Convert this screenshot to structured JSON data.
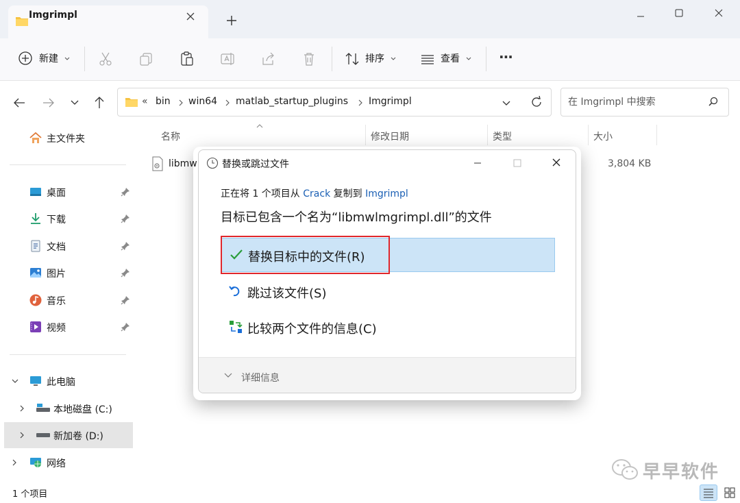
{
  "tab": {
    "title": "Imgrimpl",
    "icon": "folder-icon",
    "add": "+"
  },
  "toolbar": {
    "new_label": "新建",
    "sort_label": "排序",
    "view_label": "查看",
    "more": "···"
  },
  "address": {
    "overflow": "«",
    "crumbs": [
      "bin",
      "win64",
      "matlab_startup_plugins",
      "Imgrimpl"
    ]
  },
  "search": {
    "placeholder": "在 Imgrimpl 中搜索"
  },
  "sidebar": {
    "home": "主文件夹",
    "pinned": [
      {
        "label": "桌面",
        "icon": "desktop-icon"
      },
      {
        "label": "下载",
        "icon": "download-icon"
      },
      {
        "label": "文档",
        "icon": "document-icon"
      },
      {
        "label": "图片",
        "icon": "picture-icon"
      },
      {
        "label": "音乐",
        "icon": "music-icon"
      },
      {
        "label": "视频",
        "icon": "video-icon"
      }
    ],
    "this_pc": "此电脑",
    "drive_c": "本地磁盘 (C:)",
    "drive_d": "新加卷 (D:)",
    "network": "网络"
  },
  "columns": {
    "name": "名称",
    "date": "修改日期",
    "type": "类型",
    "size": "大小"
  },
  "file": {
    "name": "libmw",
    "size": "3,804 KB"
  },
  "status": {
    "count": "1 个项目"
  },
  "dialog": {
    "title": "替换或跳过文件",
    "from_prefix": "正在将 1 个项目从 ",
    "from_source": "Crack",
    "from_mid": " 复制到 ",
    "from_dest": "Imgrimpl",
    "contains": "目标已包含一个名为“libmwlmgrimpl.dll”的文件",
    "opt_replace": "替换目标中的文件(R)",
    "opt_skip": "跳过该文件(S)",
    "opt_compare": "比较两个文件的信息(C)",
    "details": "详细信息"
  },
  "watermark": {
    "text": "早早软件"
  },
  "colors": {
    "accent": "#1a5fb4",
    "selection": "#cce4f7",
    "highlight_outline": "#e0262b",
    "check": "#2a9d3b"
  }
}
